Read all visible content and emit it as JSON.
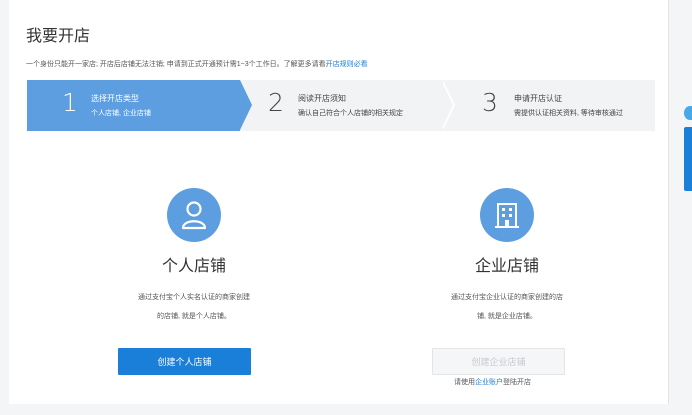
{
  "page": {
    "title": "我要开店",
    "notice_text": "一个身份只能开一家店; 开店后店铺无法注销; 申请到正式开通预计需1~3个工作日。了解更多请看",
    "notice_link": "开店规则必看"
  },
  "steps": [
    {
      "number": "1",
      "title": "选择开店类型",
      "desc": "个人店铺, 企业店铺",
      "active": true
    },
    {
      "number": "2",
      "title": "阅读开店须知",
      "desc": "确认自己符合个人店铺的相关规定",
      "active": false
    },
    {
      "number": "3",
      "title": "申请开店认证",
      "desc": "需提供认证相关资料, 等待审核通过",
      "active": false
    }
  ],
  "personal": {
    "icon": "user-icon",
    "name": "个人店铺",
    "desc_line1": "通过支付宝个人实名认证的商家创建",
    "desc_line2": "的店铺, 就是个人店铺。",
    "button": "创建个人店铺"
  },
  "company": {
    "icon": "building-icon",
    "name": "企业店铺",
    "desc_line1": "通过支付宝企业认证的商家创建的店",
    "desc_line2": "铺, 就是企业店铺。",
    "button": "创建企业店铺",
    "hint_prefix": "请使用",
    "hint_link": "企业账户",
    "hint_suffix": "登陆开店"
  },
  "colors": {
    "accent": "#1a7fd9",
    "step_active": "#5c9ee0",
    "icon_bg": "#5c9ee0"
  }
}
